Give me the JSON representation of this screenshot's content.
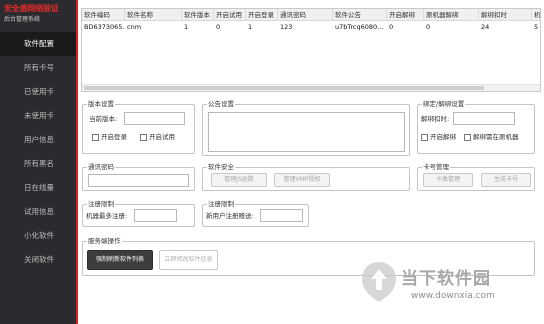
{
  "sidebar": {
    "brand_title": "安全盾网络验证",
    "brand_subtitle": "后台管理系统",
    "items": [
      {
        "label": "软件配置",
        "active": true
      },
      {
        "label": "所有卡号",
        "active": false
      },
      {
        "label": "已使用卡",
        "active": false
      },
      {
        "label": "未使用卡",
        "active": false
      },
      {
        "label": "用户信息",
        "active": false
      },
      {
        "label": "所有黑名",
        "active": false
      },
      {
        "label": "日在线量",
        "active": false
      },
      {
        "label": "试用信息",
        "active": false
      },
      {
        "label": "小化软件",
        "active": false
      },
      {
        "label": "关闭软件",
        "active": false
      }
    ]
  },
  "grid": {
    "columns": [
      "软件编码",
      "软件名称",
      "软件版本",
      "开启试用",
      "开启登录",
      "通讯密码",
      "软件公告",
      "开启解绑",
      "原机器解绑",
      "解绑扣时",
      "机"
    ],
    "rows": [
      [
        "BD6373065...",
        "cnm",
        "1",
        "0",
        "1",
        "123",
        "u7bTrcq6080...",
        "0",
        "0",
        "24",
        "5"
      ]
    ]
  },
  "version_settings": {
    "title": "版本设置",
    "current_version_label": "当前版本:",
    "current_version_value": "",
    "open_login_label": "开启登录",
    "open_trial_label": "开启试用"
  },
  "announcement": {
    "title": "公告设置",
    "value": ""
  },
  "unbind_settings": {
    "title": "绑定/解绑设置",
    "deduct_label": "解绑扣时:",
    "deduct_value": "",
    "enable_unbind_label": "开启解绑",
    "unbind_original_label": "解绑需在原机器"
  },
  "comm_password": {
    "title": "通讯密码",
    "value": ""
  },
  "software_security": {
    "title": "软件安全",
    "manage_js_label": "管理JS函数",
    "manage_vmp_label": "管理VMP授权"
  },
  "card_management": {
    "title": "卡号管理",
    "card_manage_label": "卡类管理",
    "generate_label": "生成卡号"
  },
  "register_limit_1": {
    "title": "注册限制",
    "machine_max_label": "机器最多注册:",
    "machine_max_value": ""
  },
  "register_limit_2": {
    "title": "注册限制",
    "new_user_label": "新用户注册赠送:",
    "new_user_value": ""
  },
  "server_ops": {
    "title": "服务端操作",
    "force_refresh_label": "强制刷新软件列表",
    "modify_info_label": "立即修改软件信息"
  },
  "watermark": {
    "title": "当下软件园",
    "url": "www.downxia.com"
  },
  "colors": {
    "sidebar_bg": "#2b2b2f",
    "accent_red": "#d81e1e",
    "brand_red": "#e52a2a",
    "primary_button": "#3d3d3d"
  }
}
